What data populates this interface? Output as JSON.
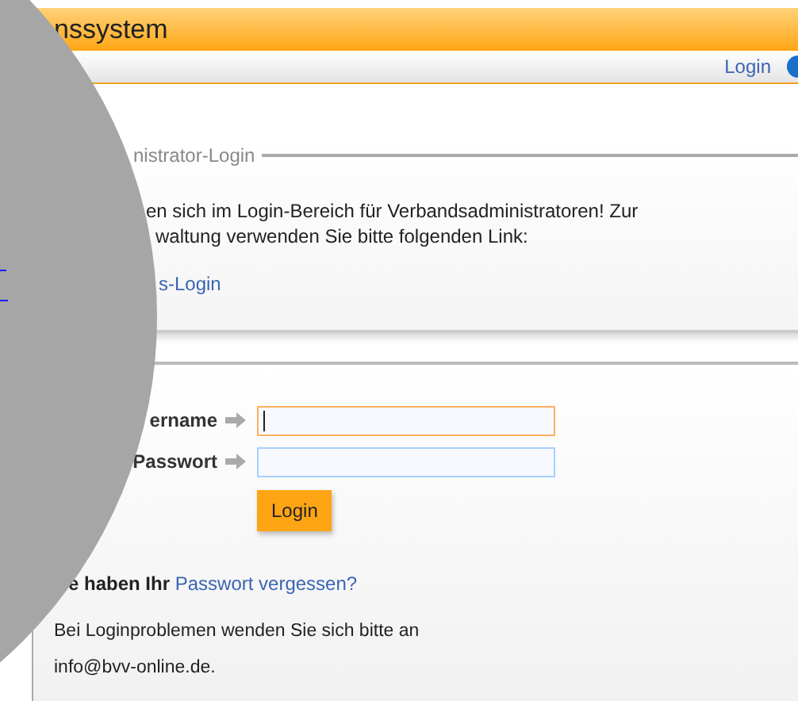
{
  "header": {
    "title": "nssystem"
  },
  "nav": {
    "links": [
      "Login"
    ]
  },
  "admin_panel": {
    "legend": "nistrator-Login",
    "text_lines": [
      "en sich im Login-Bereich für Verbandsadministratoren! Zur",
      "waltung verwenden Sie bitte folgenden Link:"
    ],
    "link": "s-Login"
  },
  "login_form": {
    "fields": [
      {
        "label": "ername",
        "focused": true
      },
      {
        "label": "Passwort",
        "focused": false
      }
    ],
    "button": "Login"
  },
  "forgot": {
    "text": "e haben Ihr",
    "link": "Passwort vergessen?"
  },
  "contact_lines": [
    "Bei Loginproblemen wenden Sie sich bitte an",
    "info@bvv-online.de."
  ]
}
